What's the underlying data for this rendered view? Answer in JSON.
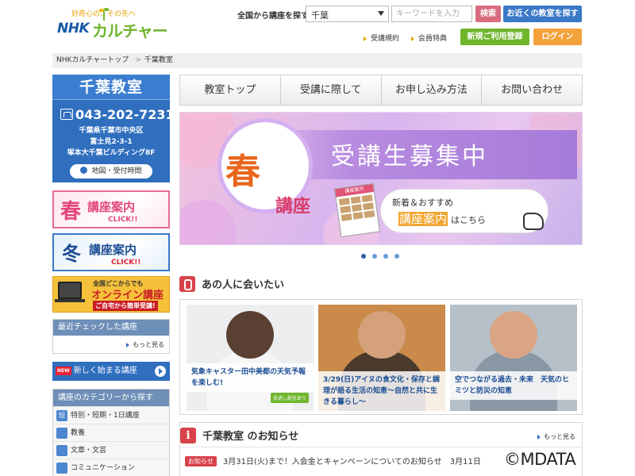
{
  "header": {
    "logo_tagline": "好奇心の、その先へ",
    "logo_nhk": "NHK",
    "logo_culture": "カルチャー",
    "search_label": "全国から講座を探す",
    "prefecture_value": "千葉",
    "keyword_placeholder": "キーワードを入力",
    "search_button": "検索",
    "nearby_button": "お近くの教室を探す",
    "link_terms": "受講規約",
    "link_member": "会員特典",
    "register_button": "新規ご利用登録",
    "login_button": "ログイン"
  },
  "breadcrumb": {
    "home": "NHKカルチャートップ",
    "current": "千葉教室"
  },
  "sidebar": {
    "school_name": "千葉教室",
    "phone": "043-202-7231",
    "address_line1": "千葉県千葉市中央区",
    "address_line2": "富士見2-3-1",
    "address_line3": "塚本大千葉ビルディング8F",
    "map_button": "地図・受付時間",
    "spring_char": "春",
    "spring_text": "講座案内",
    "spring_click": "CLICK!!",
    "winter_char": "冬",
    "winter_text": "講座案内",
    "winter_click": "CLICK!!",
    "online_line1": "全国どこからでも",
    "online_line2": "オンライン講座",
    "online_line3": "ご自宅から簡単受講!",
    "recent_title": "最近チェックした講座",
    "recent_more": "もっと見る",
    "new_badge": "NEW",
    "new_course": "新しく始まる講座",
    "category_title": "講座のカテゴリーから探す",
    "categories": [
      {
        "icon": "短",
        "label": "特別・短期・1日講座"
      },
      {
        "icon": "",
        "label": "教養"
      },
      {
        "icon": "",
        "label": "文章・文芸"
      },
      {
        "icon": "",
        "label": "コミュニケーション"
      }
    ]
  },
  "nav": {
    "tabs": [
      "教室トップ",
      "受講に際して",
      "お申し込み方法",
      "お問い合わせ"
    ]
  },
  "hero": {
    "spring": "春",
    "kouza": "講座",
    "headline": "受講生募集中",
    "flyer_title": "講座案内",
    "bubble_line1": "新着＆おすすめ",
    "bubble_highlight": "講座案内",
    "bubble_suffix": "はこちら"
  },
  "carousel": {
    "count": 4,
    "active": 0
  },
  "feature": {
    "title": "あの人に会いたい",
    "cards": [
      {
        "caption": "気象キャスター田中美都の天気予報を楽しむ!",
        "badge": "見逃し配信あり"
      },
      {
        "caption": "3/29(日)アイヌの食文化・保存と調理が語る生活の知恵～自然と共に生きる暮らし～"
      },
      {
        "caption": "空でつながる過去・未来　天気のヒミツと防災の知恵"
      }
    ]
  },
  "news": {
    "title": "千葉教室 のお知らせ",
    "more": "もっと見る",
    "tag": "お知らせ",
    "text": "3月31日(火)まで！入会金とキャンペーンについてのお知らせ",
    "date": "3月11日"
  },
  "copyright": "©MDATA",
  "colors": {
    "primary_blue": "#2f6fbe",
    "accent_green": "#6eb52b",
    "accent_orange": "#f3a13b",
    "accent_pink": "#d96d80",
    "alert_red": "#d8424a"
  }
}
